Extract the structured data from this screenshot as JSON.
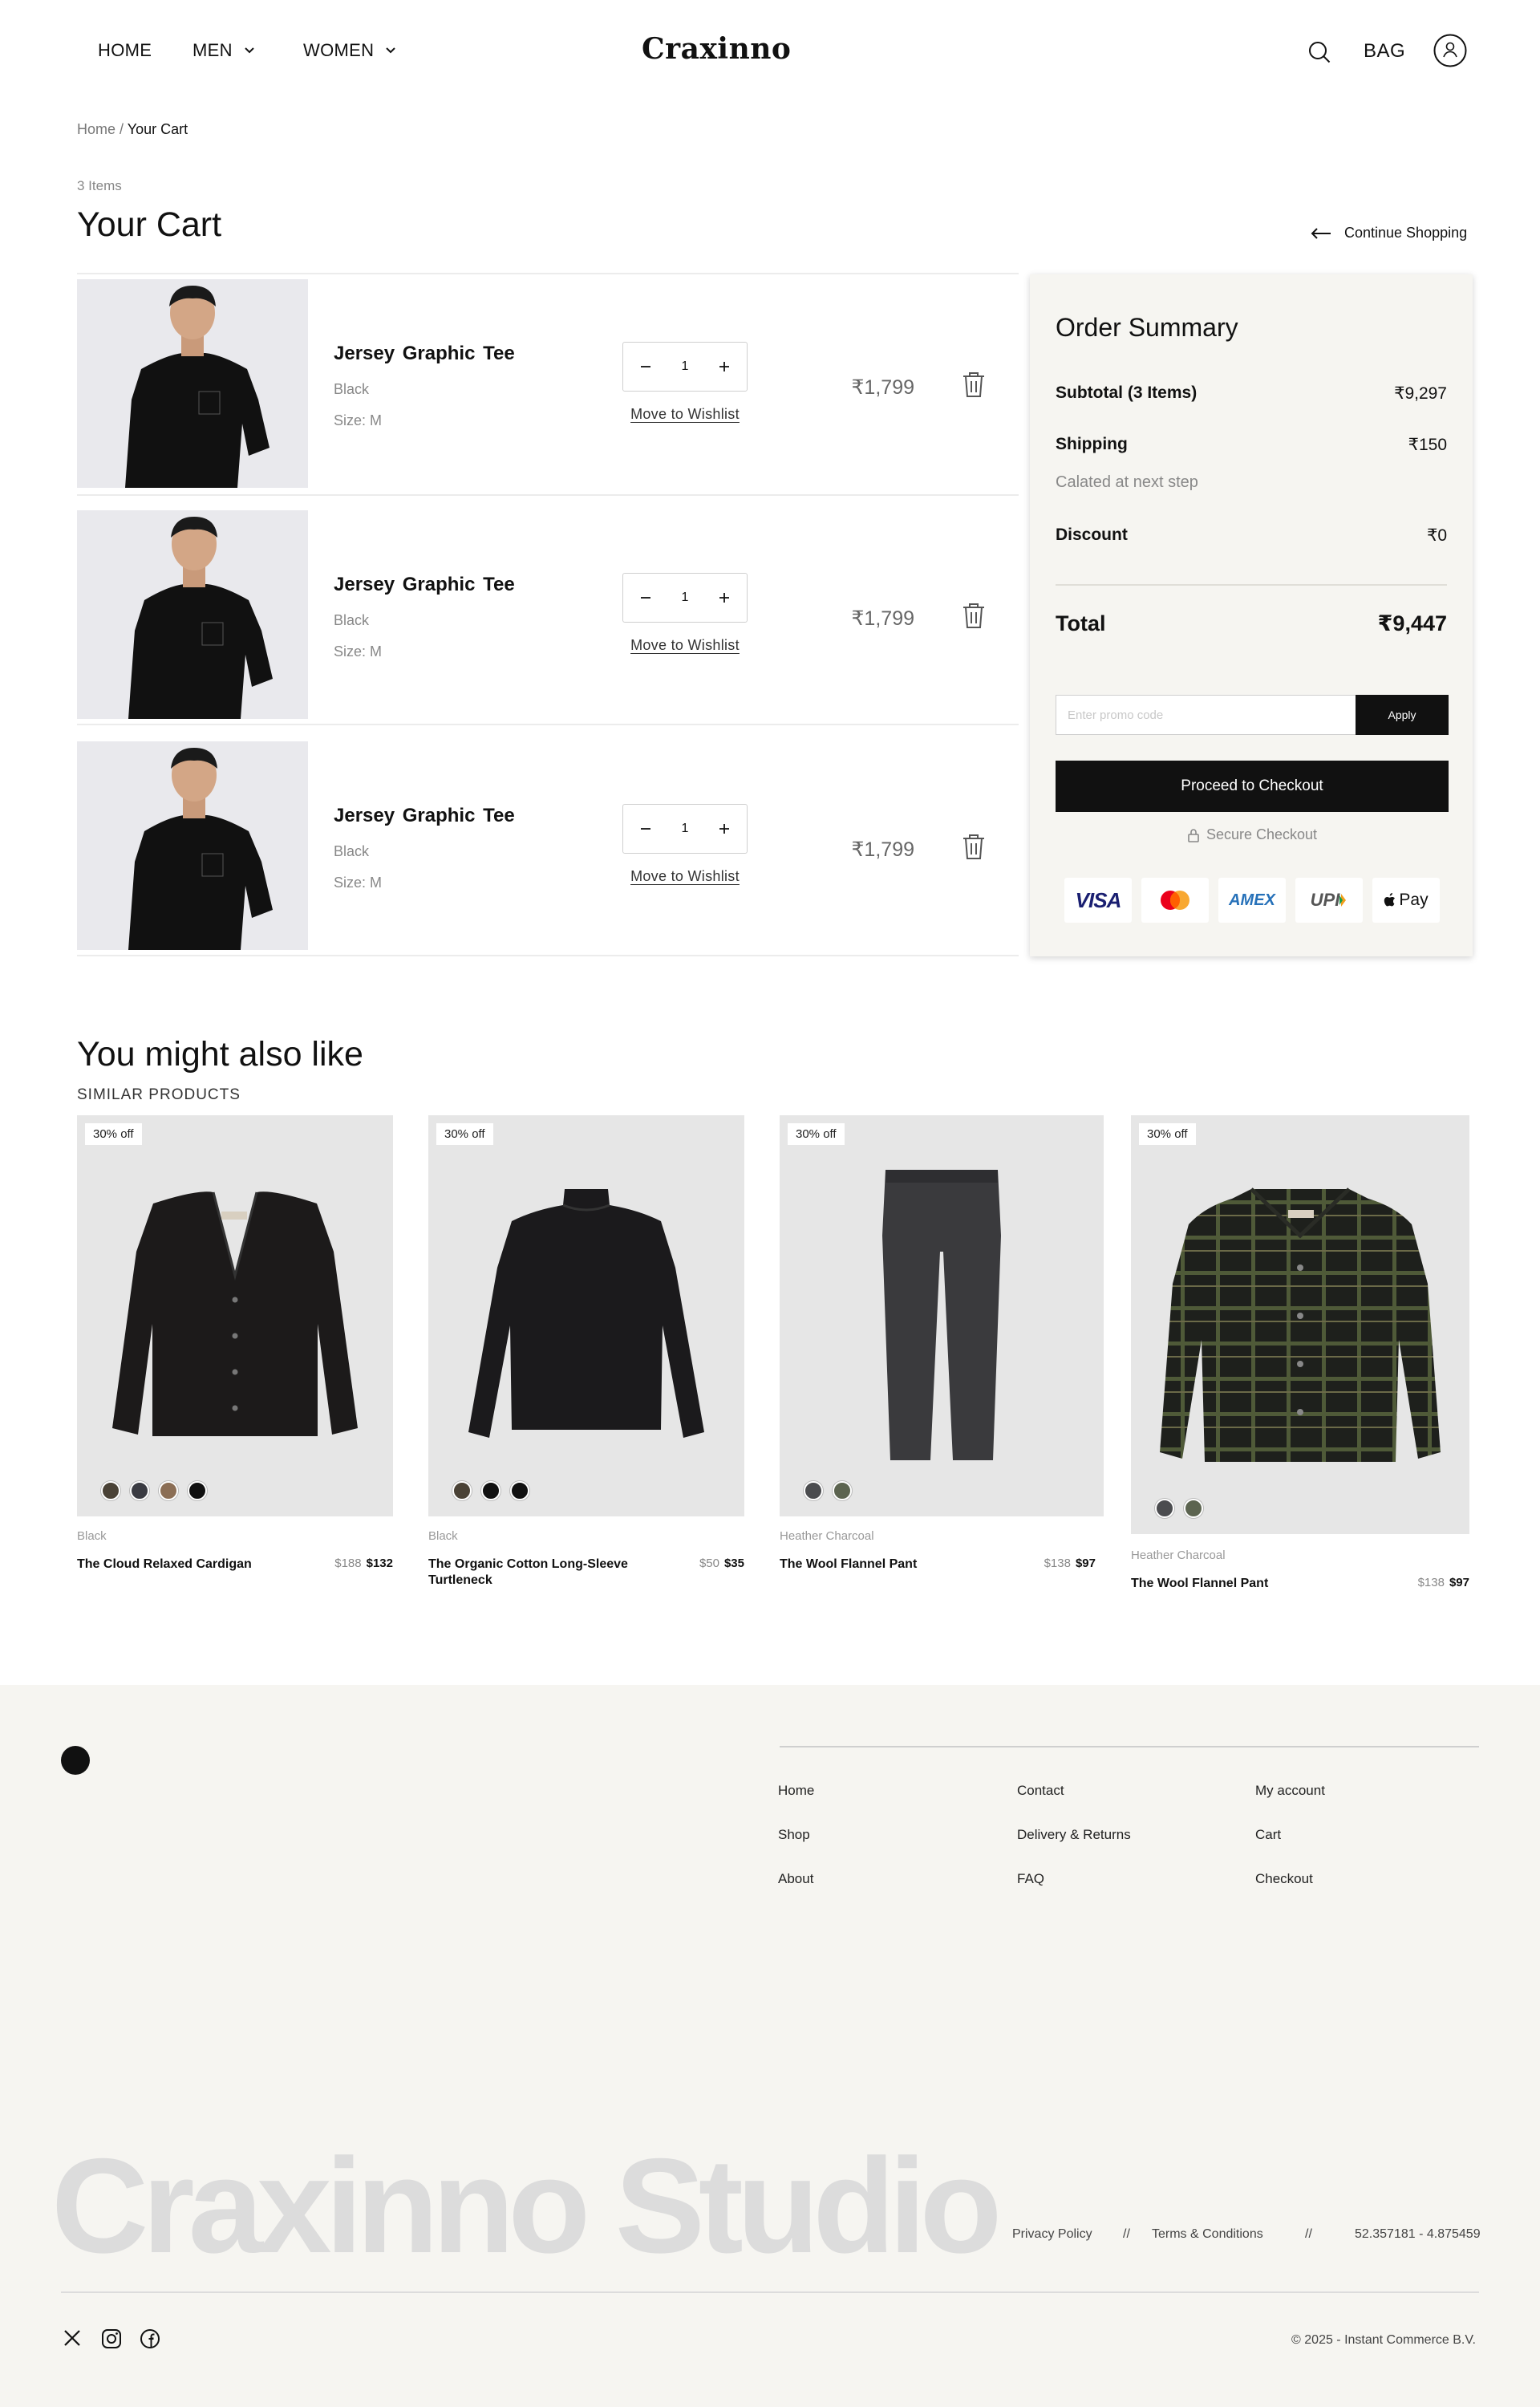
{
  "header": {
    "nav": [
      "HOME",
      "MEN",
      "WOMEN"
    ],
    "logo": "Craxinno",
    "bag_label": "BAG"
  },
  "breadcrumb": {
    "home": "Home /",
    "current": "Your Cart"
  },
  "cart": {
    "item_count": "3 Items",
    "title": "Your Cart",
    "continue_label": "Continue Shopping",
    "items": [
      {
        "name": "Jersey  Graphic Tee",
        "color": "Black",
        "size": "Size: M",
        "qty": "1",
        "wishlist": "Move to Wishlist",
        "price": "₹1,799"
      },
      {
        "name": "Jersey  Graphic Tee",
        "color": "Black",
        "size": "Size: M",
        "qty": "1",
        "wishlist": "Move to Wishlist",
        "price": "₹1,799"
      },
      {
        "name": "Jersey  Graphic Tee",
        "color": "Black",
        "size": "Size: M",
        "qty": "1",
        "wishlist": "Move to Wishlist",
        "price": "₹1,799"
      }
    ]
  },
  "summary": {
    "title": "Order Summary",
    "subtotal_label": "Subtotal (3 Items)",
    "subtotal_value": "₹9,297",
    "shipping_label": "Shipping",
    "shipping_value": "₹150",
    "shipping_note": "Calated at next step",
    "discount_label": "Discount",
    "discount_value": "₹0",
    "total_label": "Total",
    "total_value": "₹9,447",
    "promo_placeholder": "Enter promo code",
    "apply_label": "Apply",
    "checkout_label": "Proceed to Checkout",
    "secure_label": "Secure Checkout",
    "payment_methods": [
      "VISA",
      "mastercard",
      "AMEX",
      "UPI",
      "Pay"
    ]
  },
  "similar": {
    "title": "You might also like",
    "subtitle": "SIMILAR PRODUCTS",
    "products": [
      {
        "badge": "30% off",
        "color": "Black",
        "name": "The Cloud Relaxed Cardigan",
        "old_price": "$188",
        "new_price": "$132",
        "swatches": [
          "#4a4236",
          "#3a3b42",
          "#8b6e55",
          "#111111"
        ]
      },
      {
        "badge": "30% off",
        "color": "Black",
        "name": "The Organic Cotton Long-Sleeve Turtleneck",
        "old_price": "$50",
        "new_price": "$35",
        "swatches": [
          "#4a4236",
          "#111111",
          "#111111"
        ]
      },
      {
        "badge": "30% off",
        "color": "Heather Charcoal",
        "name": "The Wool Flannel Pant",
        "old_price": "$138",
        "new_price": "$97",
        "swatches": [
          "#4b4c4f",
          "#5c6450"
        ]
      },
      {
        "badge": "30% off",
        "color": "Heather Charcoal",
        "name": "The Wool Flannel Pant",
        "old_price": "$138",
        "new_price": "$97",
        "swatches": [
          "#4b4c4f",
          "#5c6450"
        ]
      }
    ]
  },
  "footer": {
    "col1": [
      "Home",
      "Shop",
      "About"
    ],
    "col2": [
      "Contact",
      "Delivery & Returns",
      "FAQ"
    ],
    "col3": [
      "My account",
      "Cart",
      "Checkout"
    ],
    "brand": "Craxinno Studio",
    "privacy": "Privacy Policy",
    "sep": "//",
    "terms": "Terms & Conditions",
    "coords": "52.357181 - 4.875459",
    "copyright": "© 2025 - Instant Commerce B.V."
  }
}
